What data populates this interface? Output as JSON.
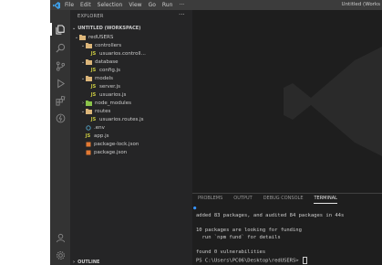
{
  "titlebar": {
    "menu": [
      "File",
      "Edit",
      "Selection",
      "View",
      "Go",
      "Run",
      "···"
    ],
    "window_title": "Untitled (Works"
  },
  "colors": {
    "activity_bg": "#333333",
    "sidebar_bg": "#252526",
    "editor_bg": "#1e1e1e",
    "titlebar_bg": "#3c3c3c",
    "folder_yellow": "#dcb67a",
    "js_yellow": "#cbcb41",
    "json_orange": "#e37933",
    "env_blue": "#519aba",
    "logo_blue": "#3e9fe8"
  },
  "activity_icons": [
    "explorer-icon",
    "search-icon",
    "source-control-icon",
    "run-debug-icon",
    "extensions-icon",
    "remote-icon",
    "account-icon",
    "settings-gear-icon"
  ],
  "sidebar": {
    "header": "EXPLORER",
    "more_actions": "···",
    "workspace": "UNTITLED (WORKSPACE)",
    "tree": [
      {
        "label": "redUSERS",
        "kind": "folder",
        "expanded": true
      },
      {
        "label": "controllers",
        "kind": "folder",
        "expanded": true
      },
      {
        "label": "usuarios.controll...",
        "kind": "js"
      },
      {
        "label": "database",
        "kind": "folder",
        "expanded": true
      },
      {
        "label": "config.js",
        "kind": "js"
      },
      {
        "label": "models",
        "kind": "folder",
        "expanded": true
      },
      {
        "label": "server.js",
        "kind": "js"
      },
      {
        "label": "usuarios.js",
        "kind": "js"
      },
      {
        "label": "node_modules",
        "kind": "folder",
        "expanded": false
      },
      {
        "label": "routes",
        "kind": "folder",
        "expanded": true
      },
      {
        "label": "usuarios.routes.js",
        "kind": "js"
      },
      {
        "label": ".env",
        "kind": "env"
      },
      {
        "label": "app.js",
        "kind": "js"
      },
      {
        "label": "package-lock.json",
        "kind": "json"
      },
      {
        "label": "package.json",
        "kind": "json"
      }
    ],
    "outline": "OUTLINE"
  },
  "panel": {
    "tabs": [
      "PROBLEMS",
      "OUTPUT",
      "DEBUG CONSOLE",
      "TERMINAL"
    ],
    "active_tab": "TERMINAL",
    "terminal_lines": [
      "added 83 packages, and audited 84 packages in 44s",
      "",
      "10 packages are looking for funding",
      "  run `npm fund` for details",
      "",
      "found 0 vulnerabilities",
      "PS C:\\Users\\PC06\\Desktop\\redUSERS> "
    ]
  }
}
